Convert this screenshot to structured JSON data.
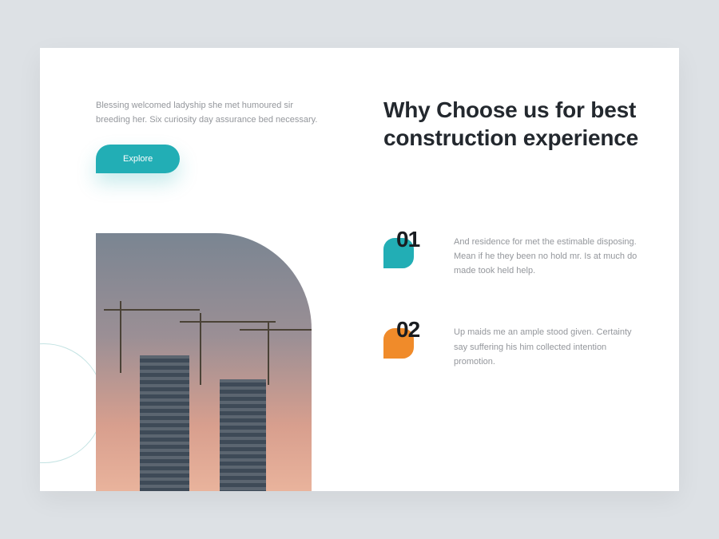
{
  "intro": "Blessing welcomed ladyship she met humoured sir breeding her. Six curiosity day assurance bed necessary.",
  "cta": {
    "label": "Explore"
  },
  "headline": "Why Choose us for best construction experience",
  "features": [
    {
      "num": "01",
      "text": "And residence for met the estimable disposing. Mean if he they been no hold mr. Is at much do made took held help.",
      "color": "teal"
    },
    {
      "num": "02",
      "text": "Up maids me an ample stood given. Certainty say suffering his him collected intention promotion.",
      "color": "orange"
    }
  ]
}
